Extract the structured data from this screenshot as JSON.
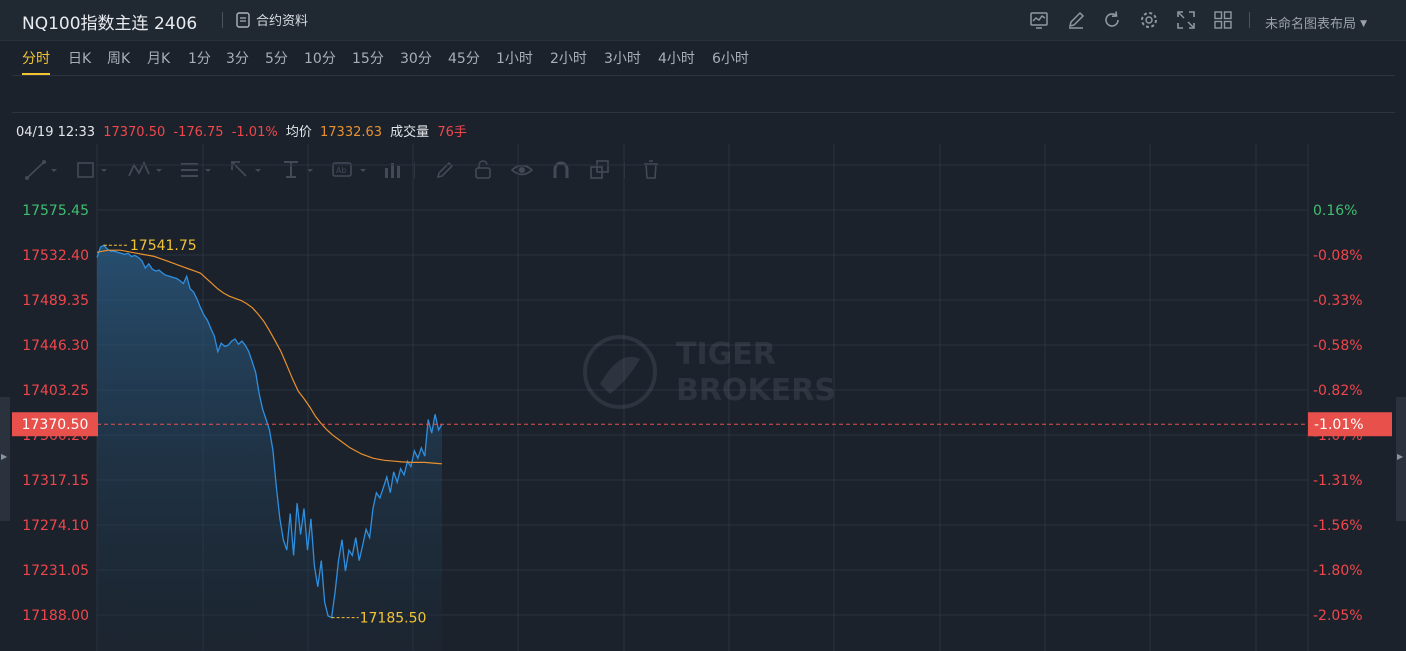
{
  "header": {
    "title": "NQ100指数主连 2406",
    "contract_info_label": "合约资料",
    "layout_label": "未命名图表布局"
  },
  "toolbar_icons": [
    "chart-icon",
    "edit-icon",
    "refresh-icon",
    "gear-icon",
    "fullscreen-icon",
    "grid-icon"
  ],
  "periods": [
    {
      "label": "分时",
      "active": true
    },
    {
      "label": "日K"
    },
    {
      "label": "周K"
    },
    {
      "label": "月K"
    },
    {
      "label": "1分"
    },
    {
      "label": "3分"
    },
    {
      "label": "5分"
    },
    {
      "label": "10分"
    },
    {
      "label": "15分"
    },
    {
      "label": "30分"
    },
    {
      "label": "45分"
    },
    {
      "label": "1小时"
    },
    {
      "label": "2小时"
    },
    {
      "label": "3小时"
    },
    {
      "label": "4小时"
    },
    {
      "label": "6小时"
    }
  ],
  "drawing_tools": [
    "line-tool-icon",
    "rect-tool-icon",
    "wave-tool-icon",
    "fib-tool-icon",
    "arrow-tool-icon",
    "text-tool-icon",
    "label-tool-icon",
    "measure-tool-icon",
    "pen-icon",
    "lock-icon",
    "eye-icon",
    "magnet-icon",
    "copy-icon",
    "trash-icon"
  ],
  "quote": {
    "datetime": "04/19 12:33",
    "price": "17370.50",
    "change": "-176.75",
    "change_pct": "-1.01%",
    "avg_label": "均价",
    "avg_value": "17332.63",
    "volume_label": "成交量",
    "volume_value": "76手"
  },
  "colors": {
    "up": "#3fbf6f",
    "down": "#f0474b",
    "price_line": "#2e8fe0",
    "avg_line": "#e8912e",
    "marker_text": "#f2c434",
    "current_tag": "#e8504c"
  },
  "watermark": {
    "line1": "TIGER",
    "line2": "BROKERS"
  },
  "chart_data": {
    "type": "line",
    "y_left_ticks": [
      "17575.45",
      "17532.40",
      "17489.35",
      "17446.30",
      "17403.25",
      "17360.20",
      "17317.15",
      "17274.10",
      "17231.05",
      "17188.00"
    ],
    "y_right_ticks": [
      "0.16%",
      "-0.08%",
      "-0.33%",
      "-0.58%",
      "-0.82%",
      "-1.07%",
      "-1.31%",
      "-1.56%",
      "-1.80%",
      "-2.05%"
    ],
    "ylim": [
      17188.0,
      17575.45
    ],
    "prev_close": 17547.25,
    "high_label": "17541.75",
    "low_label": "17185.50",
    "current_price": "17370.50",
    "current_pct": "-1.01%",
    "series": [
      {
        "name": "价格",
        "values": [
          17530,
          17540,
          17541.75,
          17538,
          17536,
          17536,
          17535,
          17534,
          17533,
          17534,
          17531,
          17532,
          17530,
          17527,
          17520,
          17524,
          17519,
          17517,
          17518,
          17515,
          17513,
          17512,
          17511,
          17510,
          17508,
          17505,
          17512,
          17500,
          17497,
          17490,
          17482,
          17475,
          17470,
          17462,
          17455,
          17440,
          17448,
          17445,
          17446,
          17450,
          17452,
          17447,
          17450,
          17446,
          17440,
          17430,
          17420,
          17400,
          17385,
          17375,
          17365,
          17345,
          17310,
          17280,
          17260,
          17250,
          17285,
          17245,
          17295,
          17265,
          17290,
          17250,
          17280,
          17235,
          17215,
          17240,
          17200,
          17187,
          17185.5,
          17210,
          17240,
          17260,
          17230,
          17250,
          17245,
          17262,
          17240,
          17255,
          17270,
          17262,
          17290,
          17305,
          17300,
          17310,
          17320,
          17305,
          17325,
          17315,
          17328,
          17322,
          17335,
          17330,
          17345,
          17338,
          17348,
          17340,
          17375,
          17362,
          17380,
          17365,
          17370.5
        ]
      },
      {
        "name": "均价",
        "values": [
          17535,
          17536,
          17537,
          17537,
          17537,
          17536,
          17535,
          17534,
          17533,
          17532,
          17531,
          17529,
          17527,
          17525,
          17523,
          17521,
          17519,
          17517,
          17515,
          17510,
          17505,
          17500,
          17496,
          17493,
          17491,
          17489,
          17486,
          17482,
          17476,
          17469,
          17460,
          17450,
          17440,
          17427,
          17414,
          17402,
          17395,
          17387,
          17378,
          17371,
          17365,
          17360,
          17356,
          17352,
          17348,
          17345,
          17342,
          17340,
          17338,
          17337,
          17336,
          17335.5,
          17335,
          17334.5,
          17334.2,
          17334.0,
          17334.0,
          17334.0,
          17333.5,
          17333.0,
          17332.63
        ]
      }
    ]
  }
}
